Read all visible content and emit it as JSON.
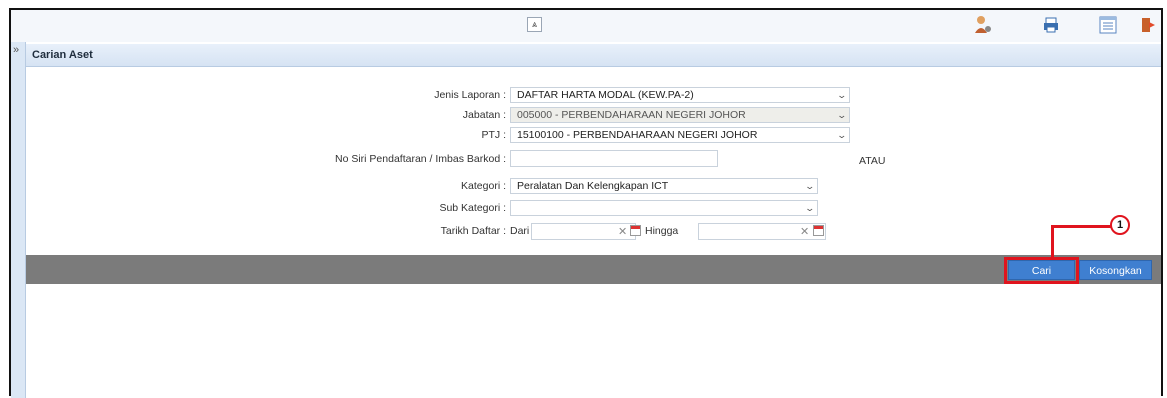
{
  "topbar": {
    "collapse_symbol": "⩓",
    "icons": [
      "user-settings-icon",
      "print-icon",
      "list-view-icon",
      "logout-icon"
    ]
  },
  "leftstrip": {
    "expand_symbol": "»"
  },
  "panel": {
    "title": "Carian Aset"
  },
  "form": {
    "jenis_laporan": {
      "label": "Jenis Laporan :",
      "value": "DAFTAR HARTA MODAL (KEW.PA-2)"
    },
    "jabatan": {
      "label": "Jabatan :",
      "value": "005000 - PERBENDAHARAAN NEGERI JOHOR"
    },
    "ptj": {
      "label": "PTJ :",
      "value": "15100100 - PERBENDAHARAAN NEGERI JOHOR"
    },
    "no_siri": {
      "label": "No Siri Pendaftaran / Imbas Barkod :",
      "value": ""
    },
    "atau": "ATAU",
    "kategori": {
      "label": "Kategori :",
      "value": "Peralatan Dan Kelengkapan ICT"
    },
    "sub_kategori": {
      "label": "Sub Kategori :",
      "value": ""
    },
    "tarikh_daftar": {
      "label": "Tarikh Daftar :",
      "dari": "Dari",
      "hingga": "Hingga",
      "dari_value": "",
      "hingga_value": ""
    }
  },
  "actions": {
    "cari": "Cari",
    "kosongkan": "Kosongkan"
  },
  "annotation": {
    "step": "1"
  },
  "colors": {
    "accent": "#3f7fd0",
    "highlight": "#e0141e",
    "actionbar": "#7b7b7b"
  }
}
